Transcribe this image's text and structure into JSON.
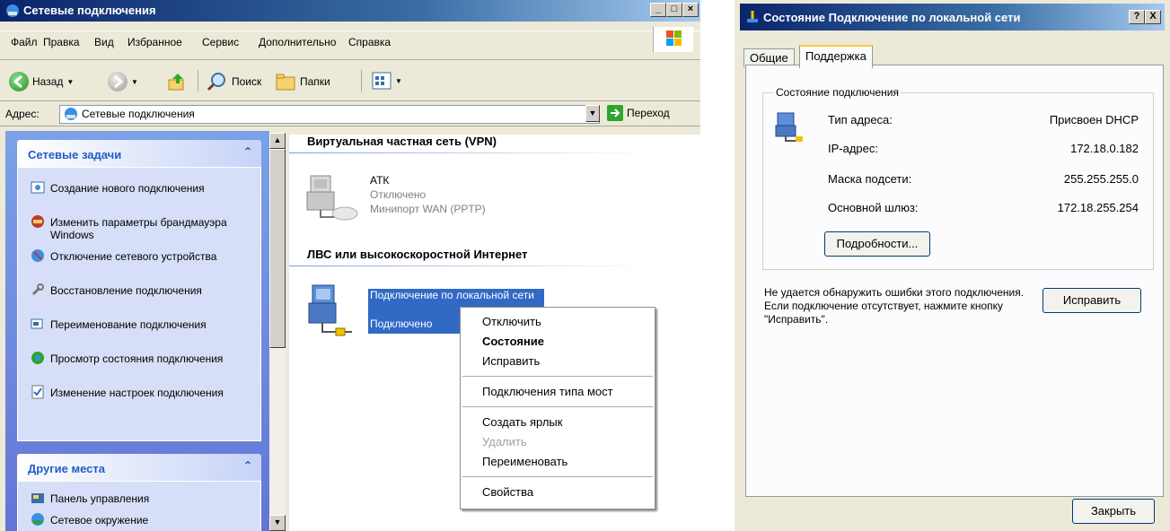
{
  "explorer": {
    "title": "Сетевые подключения",
    "menu": [
      "Файл",
      "Правка",
      "Вид",
      "Избранное",
      "Сервис",
      "Дополнительно",
      "Справка"
    ],
    "toolbar": {
      "back": "Назад",
      "search": "Поиск",
      "folders": "Папки"
    },
    "address": {
      "label": "Адрес:",
      "value": "Сетевые подключения",
      "go": "Переход"
    },
    "tasks_panel": {
      "title": "Сетевые задачи",
      "items": [
        {
          "label": "Создание нового подключения",
          "icon": "new-connection-icon"
        },
        {
          "label": "Изменить параметры брандмауэра Windows",
          "icon": "firewall-icon"
        },
        {
          "label": "Отключение сетевого устройства",
          "icon": "disable-device-icon"
        },
        {
          "label": "Восстановление подключения",
          "icon": "repair-icon"
        },
        {
          "label": "Переименование подключения",
          "icon": "rename-icon"
        },
        {
          "label": "Просмотр состояния подключения",
          "icon": "status-icon"
        },
        {
          "label": "Изменение настроек подключения",
          "icon": "settings-icon"
        }
      ]
    },
    "other_panel": {
      "title": "Другие места",
      "items": [
        {
          "label": "Панель управления",
          "icon": "control-panel-icon"
        },
        {
          "label": "Сетевое окружение",
          "icon": "network-neighborhood-icon"
        }
      ]
    },
    "groups": [
      {
        "title": "Виртуальная частная сеть (VPN)"
      },
      {
        "title": "ЛВС или высокоскоростной Интернет"
      }
    ],
    "vpn": {
      "name": "АТК",
      "status": "Отключено",
      "device": "Минипорт WAN (PPTP)"
    },
    "lan": {
      "name": "Подключение по локальной сети",
      "status": "Подключено"
    },
    "context_menu": {
      "disconnect": "Отключить",
      "status": "Состояние",
      "repair": "Исправить",
      "bridge": "Подключения типа мост",
      "shortcut": "Создать ярлык",
      "delete": "Удалить",
      "rename": "Переименовать",
      "properties": "Свойства"
    }
  },
  "dialog": {
    "title": "Состояние Подключение по локальной сети",
    "help_button": "?",
    "close_x": "X",
    "tabs": [
      "Общие",
      "Поддержка"
    ],
    "group_title": "Состояние подключения",
    "rows": [
      {
        "label": "Тип адреса:",
        "value": "Присвоен DHCP"
      },
      {
        "label": "IP-адрес:",
        "value": "172.18.0.182"
      },
      {
        "label": "Маска подсети:",
        "value": "255.255.255.0"
      },
      {
        "label": "Основной шлюз:",
        "value": "172.18.255.254"
      }
    ],
    "details_button": "Подробности...",
    "repair_text": "Не удается обнаружить ошибки этого подключения. Если подключение отсутствует, нажмите кнопку \"Исправить\".",
    "repair_button": "Исправить",
    "close_button": "Закрыть"
  },
  "colors": {
    "title_blue": "#0a246a",
    "panel_blue": "#d6dff7",
    "panel_head": "#215dc6",
    "selection": "#316ac5"
  }
}
